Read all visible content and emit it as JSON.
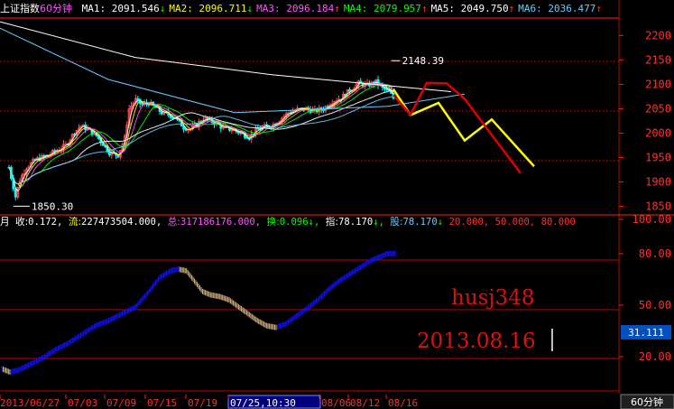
{
  "header": {
    "index_name": "上证指数",
    "period": "60分钟",
    "ma": [
      {
        "label": "MA1:",
        "value": "2091.546",
        "arrow": "↓",
        "color": "#ffffff",
        "arrow_color": "#00ff00"
      },
      {
        "label": "MA2:",
        "value": "2096.711",
        "arrow": "↓",
        "color": "#ffff00",
        "arrow_color": "#00ff00"
      },
      {
        "label": "MA3:",
        "value": "2096.184",
        "arrow": "↑",
        "color": "#ff55ff",
        "arrow_color": "#ff3030"
      },
      {
        "label": "MA4:",
        "value": "2079.957",
        "arrow": "↑",
        "color": "#00ff00",
        "arrow_color": "#ff3030"
      },
      {
        "label": "MA5:",
        "value": "2049.750",
        "arrow": "↑",
        "color": "#ffffff",
        "arrow_color": "#ff3030"
      },
      {
        "label": "MA6:",
        "value": "2036.477",
        "arrow": "↑",
        "color": "#66ccff",
        "arrow_color": "#ff3030"
      }
    ]
  },
  "sub_header": {
    "label_yue": "月",
    "shou_label": "收:",
    "shou_value": "0.172,",
    "liu_label": "流:",
    "liu_value": "227473504.000,",
    "zong_label": "总:",
    "zong_value": "317186176.000,",
    "huan_label": "换:",
    "huan_value": "0.096",
    "huan_arrow": "↓,",
    "zhi_label": "指:",
    "zhi_value": "78.170",
    "zhi_arrow": "↓,",
    "gu_label": "股:",
    "gu_value": "78.170",
    "gu_arrow": "↓",
    "levels": "20.000, 50.000, 80.000"
  },
  "chart_data": [
    {
      "type": "candlestick",
      "title": "上证指数 60分钟",
      "y_ticks": [
        2200,
        2150,
        2100,
        2050,
        2000,
        1950,
        1900,
        1850
      ],
      "ylim": [
        1840,
        2232
      ],
      "annotations": {
        "high": "2148.39",
        "low": "1850.30"
      },
      "price_path": [
        [
          0,
          1930
        ],
        [
          3,
          1870
        ],
        [
          5,
          1905
        ],
        [
          8,
          1930
        ],
        [
          12,
          1945
        ],
        [
          15,
          1950
        ],
        [
          18,
          1955
        ],
        [
          22,
          1965
        ],
        [
          26,
          1975
        ],
        [
          30,
          2002
        ],
        [
          33,
          2015
        ],
        [
          36,
          2008
        ],
        [
          40,
          1995
        ],
        [
          43,
          1978
        ],
        [
          46,
          1960
        ],
        [
          50,
          1955
        ],
        [
          53,
          1990
        ],
        [
          55,
          2050
        ],
        [
          58,
          2068
        ],
        [
          61,
          2058
        ],
        [
          64,
          2062
        ],
        [
          67,
          2052
        ],
        [
          70,
          2042
        ],
        [
          73,
          2038
        ],
        [
          76,
          2032
        ],
        [
          80,
          2012
        ],
        [
          83,
          2008
        ],
        [
          86,
          2018
        ],
        [
          89,
          2030
        ],
        [
          92,
          2025
        ],
        [
          95,
          2020
        ],
        [
          98,
          2010
        ],
        [
          102,
          2008
        ],
        [
          106,
          2000
        ],
        [
          110,
          1992
        ],
        [
          113,
          2005
        ],
        [
          116,
          2012
        ],
        [
          120,
          2015
        ],
        [
          124,
          2028
        ],
        [
          128,
          2042
        ],
        [
          132,
          2048
        ],
        [
          136,
          2050
        ],
        [
          140,
          2045
        ],
        [
          144,
          2050
        ],
        [
          148,
          2065
        ],
        [
          152,
          2072
        ],
        [
          156,
          2088
        ],
        [
          160,
          2102
        ],
        [
          164,
          2098
        ],
        [
          168,
          2105
        ],
        [
          171,
          2092
        ],
        [
          174,
          2085
        ],
        [
          176,
          2072
        ]
      ],
      "ma_short_series": {
        "name": "MA1",
        "color": "#ffffff"
      },
      "projections": [
        {
          "name": "yellow",
          "color": "#ffff00",
          "points": [
            [
              436,
              2090
            ],
            [
              455,
              2037
            ],
            [
              486,
              2062
            ],
            [
              515,
              1985
            ],
            [
              545,
              2028
            ],
            [
              592,
              1932
            ]
          ]
        },
        {
          "name": "red",
          "color": "#dd0000",
          "points": [
            [
              436,
              2078
            ],
            [
              455,
              2038
            ],
            [
              473,
              2103
            ],
            [
              495,
              2102
            ],
            [
              515,
              2070
            ],
            [
              577,
              1918
            ]
          ]
        }
      ]
    },
    {
      "type": "bar",
      "title": "",
      "y_ticks": [
        100.0,
        80.0,
        50.0,
        20.0
      ],
      "ylim": [
        0,
        100
      ],
      "current_value": "31.111",
      "values_path": [
        [
          0,
          13
        ],
        [
          6,
          11
        ],
        [
          12,
          12
        ],
        [
          20,
          15
        ],
        [
          30,
          19
        ],
        [
          40,
          24
        ],
        [
          50,
          28
        ],
        [
          60,
          33
        ],
        [
          70,
          38
        ],
        [
          80,
          41
        ],
        [
          90,
          45
        ],
        [
          100,
          49
        ],
        [
          110,
          58
        ],
        [
          118,
          66
        ],
        [
          126,
          70
        ],
        [
          132,
          71
        ],
        [
          138,
          70
        ],
        [
          144,
          64
        ],
        [
          150,
          58
        ],
        [
          156,
          56
        ],
        [
          163,
          55
        ],
        [
          170,
          53
        ],
        [
          177,
          49
        ],
        [
          184,
          45
        ],
        [
          191,
          41
        ],
        [
          198,
          38
        ],
        [
          205,
          37
        ],
        [
          212,
          39
        ],
        [
          219,
          43
        ],
        [
          228,
          48
        ],
        [
          236,
          53
        ],
        [
          244,
          59
        ],
        [
          252,
          64
        ],
        [
          260,
          68
        ],
        [
          268,
          72
        ],
        [
          276,
          76
        ],
        [
          282,
          78
        ],
        [
          288,
          80
        ],
        [
          294,
          80
        ]
      ]
    }
  ],
  "watermark": {
    "name": "husj348",
    "date": "2013.08.16"
  },
  "time_axis": {
    "ticks": [
      "2013/06/27",
      "07/03",
      "07/09",
      "07/15",
      "07/19",
      "07/25,10:30",
      "08/06",
      "08/12",
      "08/16"
    ],
    "period_button": "60分钟"
  },
  "colors": {
    "grid_red": "#c00000",
    "axis_red": "#ff2020",
    "up_candle": "#ff5050",
    "down_candle": "#00ffff",
    "bar_up": "#1010ff",
    "bar_down": "#c8a878",
    "cursor_box": "#000080"
  }
}
